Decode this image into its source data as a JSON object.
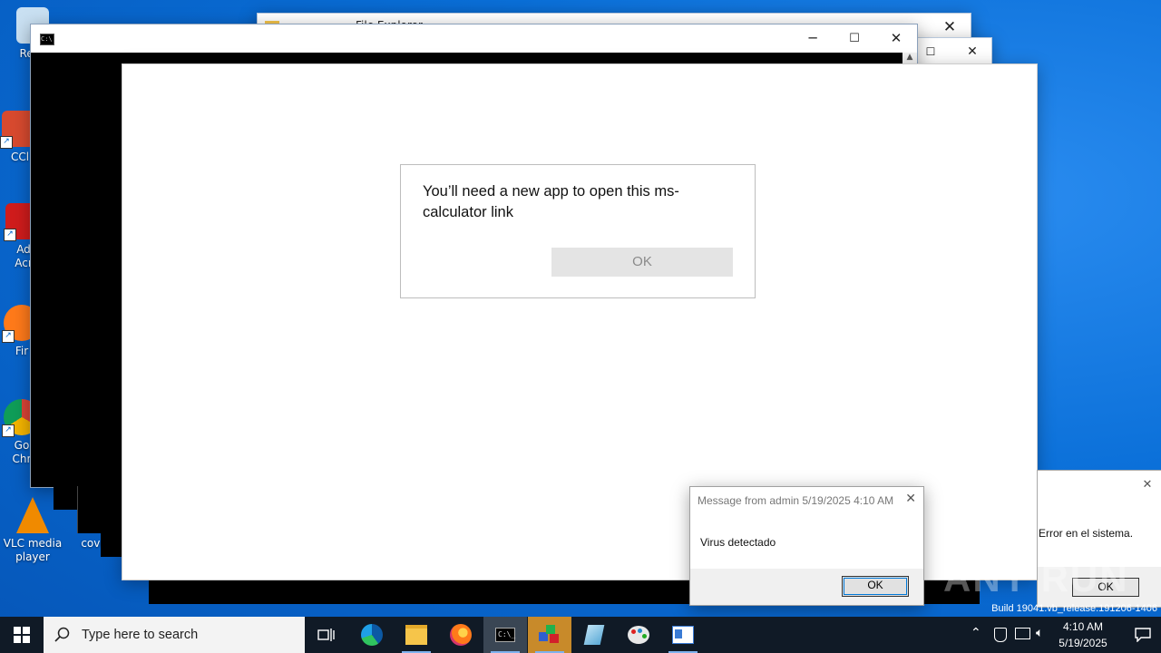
{
  "desktop": {
    "icons": [
      {
        "label": "Recy",
        "color": "#9fc7e8"
      },
      {
        "label": "CCl",
        "color": "#d84a2f"
      },
      {
        "label": "Ad\nAcr",
        "color": "#d01c1c"
      },
      {
        "label": "Fir",
        "color": "#ff7a1a"
      },
      {
        "label": "Go\nChr",
        "color": "#2f9f4a"
      },
      {
        "label": "VLC media player",
        "color": "#f08a00"
      },
      {
        "label": "cover",
        "color": "#ffffff"
      }
    ],
    "build_text": "Build 19041.vb_release.191206-1406",
    "watermark": "ANY RUN"
  },
  "file_explorer": {
    "title": "File Explorer"
  },
  "cmd_window": {
    "title": ""
  },
  "app_dialog": {
    "message": "You’ll need a new app to open this ms-calculator link",
    "ok_label": "OK"
  },
  "msg_admin": {
    "title": "Message from admin 5/19/2025 4:10 AM",
    "body": "Virus detectado",
    "ok_label": "OK"
  },
  "msg_error": {
    "body": "Error en el sistema.",
    "ok_label": "OK"
  },
  "taskbar": {
    "search_placeholder": "Type here to search",
    "time": "4:10 AM",
    "date": "5/19/2025"
  }
}
